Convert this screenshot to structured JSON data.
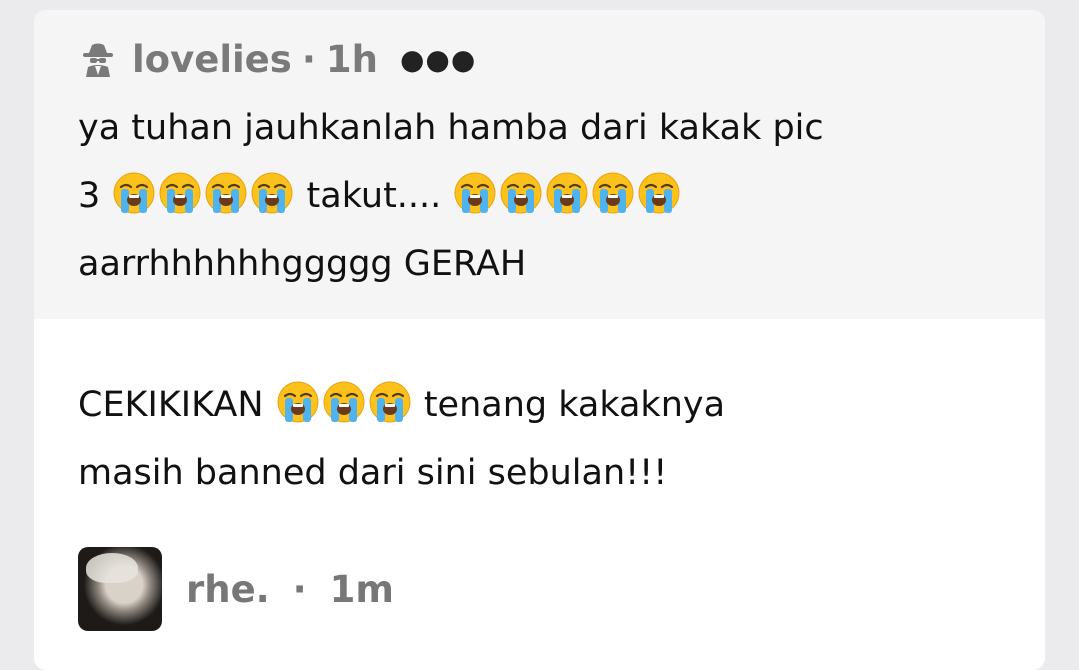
{
  "quoted_post": {
    "username": "lovelies",
    "time": "1h",
    "more_icon": "more-horizontal-icon",
    "author_icon": "anonymous-spy-icon",
    "line1": "ya tuhan jauhkanlah hamba dari kakak pic",
    "line2_prefix": "3 ",
    "line2_mid": " takut.... ",
    "line3": "aarrhhhhhhggggg GERAH",
    "emoji": "loudly-crying-face"
  },
  "post": {
    "line1_prefix": "CEKIKIKAN ",
    "line1_suffix": " tenang kakaknya",
    "line2": "masih banned dari sini sebulan!!!"
  },
  "reply": {
    "username": "rhe.",
    "time": "1m"
  },
  "colors": {
    "background": "#ebebed",
    "card": "#ffffff",
    "quoted_bg": "#f5f5f5",
    "meta_text": "#7a7a7a"
  }
}
